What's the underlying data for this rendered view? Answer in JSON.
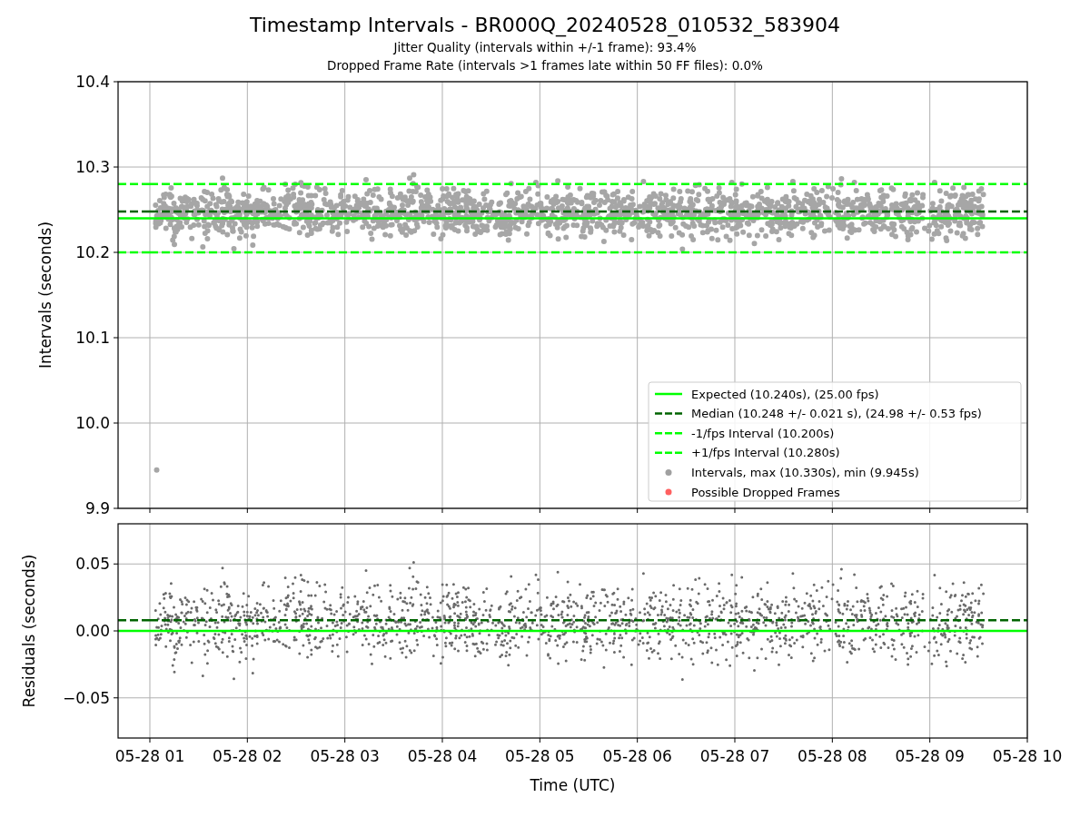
{
  "figure": {
    "title": "Timestamp Intervals - BR000Q_20240528_010532_583904",
    "subtitles": [
      "Jitter Quality (intervals within +/-1 frame): 93.4%",
      "Dropped Frame Rate (intervals >1 frames late within 50 FF files): 0.0%"
    ]
  },
  "top_chart": {
    "chart_data": {
      "type": "line",
      "ylabel": "Intervals (seconds)",
      "ylim": [
        9.9,
        10.4
      ],
      "grid": true,
      "legend": true,
      "categories": [
        null,
        null,
        null,
        null,
        null,
        null,
        null,
        null,
        null,
        null
      ],
      "yticks": [
        {
          "value": 9.9,
          "label": "9.9"
        },
        {
          "value": 10.0,
          "label": "10.0"
        },
        {
          "value": 10.1,
          "label": "10.1"
        },
        {
          "value": 10.2,
          "label": "10.2"
        },
        {
          "value": 10.3,
          "label": "10.3"
        },
        {
          "value": 10.4,
          "label": "10.4"
        }
      ],
      "series": [
        {
          "name": "Expected (10.240s), (25.00 fps)",
          "color": "#00ff00",
          "line_style": "solid",
          "values": [
            10.24,
            10.24,
            10.24,
            10.24,
            10.24,
            10.24,
            10.24,
            10.24,
            10.24,
            10.24
          ]
        },
        {
          "name": "Median (10.248 +/- 0.021 s), (24.98 +/- 0.53 fps)",
          "color": "#006400",
          "line_style": "dashed",
          "values": [
            10.248,
            10.248,
            10.248,
            10.248,
            10.248,
            10.248,
            10.248,
            10.248,
            10.248,
            10.248
          ]
        },
        {
          "name": "-1/fps Interval (10.200s)",
          "color": "#00ff00",
          "line_style": "dashed",
          "values": [
            10.2,
            10.2,
            10.2,
            10.2,
            10.2,
            10.2,
            10.2,
            10.2,
            10.2,
            10.2
          ]
        },
        {
          "name": "+1/fps Interval (10.280s)",
          "color": "#00ff00",
          "line_style": "dashed",
          "values": [
            10.28,
            10.28,
            10.28,
            10.28,
            10.28,
            10.28,
            10.28,
            10.28,
            10.28,
            10.28
          ]
        }
      ]
    },
    "legend_markers": [
      {
        "label": "Intervals, max (10.330s), min (9.945s)",
        "color": "#a0a0a0"
      },
      {
        "label": "Possible Dropped Frames",
        "color": "#ff6060"
      }
    ]
  },
  "bottom_chart": {
    "chart_data": {
      "type": "line",
      "xlabel": "Time (UTC)",
      "ylabel": "Residuals (seconds)",
      "ylim": [
        -0.08,
        0.08
      ],
      "grid": true,
      "categories": [
        "05-28 01",
        "05-28 02",
        "05-28 03",
        "05-28 04",
        "05-28 05",
        "05-28 06",
        "05-28 07",
        "05-28 08",
        "05-28 09",
        "05-28 10"
      ],
      "yticks": [
        {
          "value": -0.05,
          "label": "−0.05"
        },
        {
          "value": 0,
          "label": "0.00"
        },
        {
          "value": 0.05,
          "label": "0.05"
        }
      ],
      "series": [
        {
          "color": "#006400",
          "line_style": "dashed",
          "values": [
            0.008,
            0.008,
            0.008,
            0.008,
            0.008,
            0.008,
            0.008,
            0.008,
            0.008,
            0.008
          ]
        },
        {
          "color": "#00ff00",
          "line_style": "solid",
          "values": [
            0,
            0,
            0,
            0,
            0,
            0,
            0,
            0,
            0,
            0
          ]
        }
      ]
    }
  }
}
